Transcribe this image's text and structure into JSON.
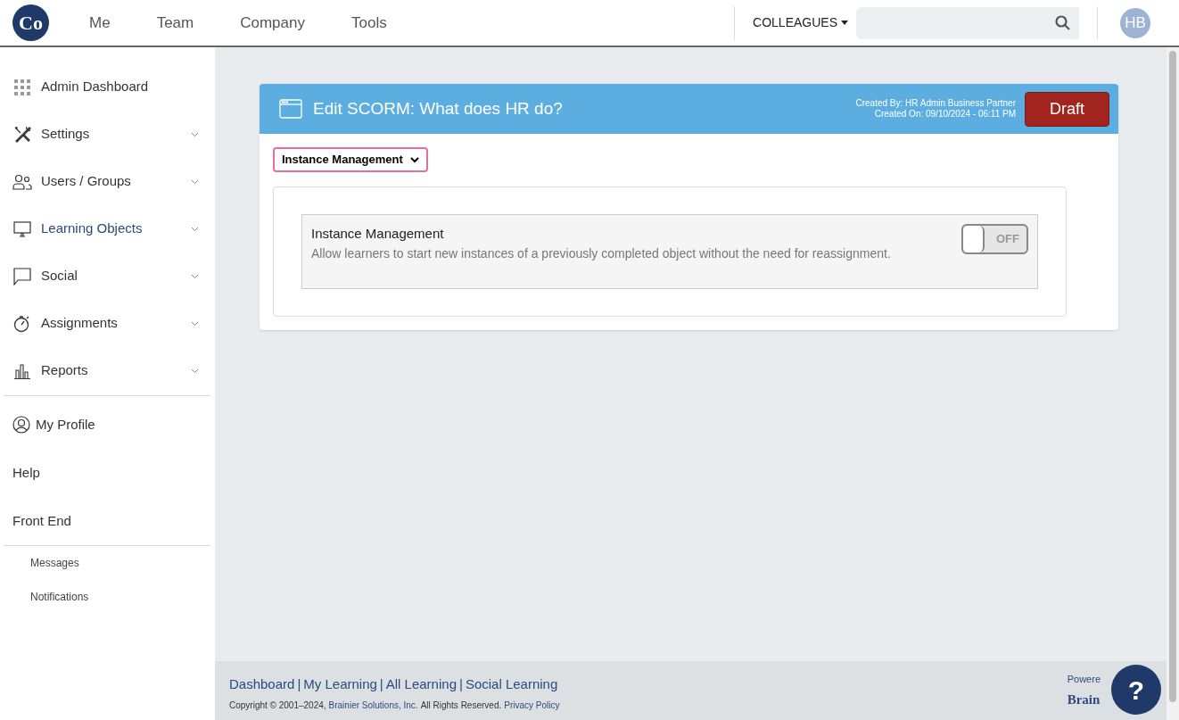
{
  "logo": {
    "text": "Co"
  },
  "nav": [
    {
      "label": "Me"
    },
    {
      "label": "Team"
    },
    {
      "label": "Company"
    },
    {
      "label": "Tools"
    }
  ],
  "search": {
    "scope": "COLLEAGUES"
  },
  "avatar": {
    "initials": "HB"
  },
  "sidebar": {
    "main": [
      {
        "label": "Admin Dashboard",
        "expandable": false,
        "selected": false
      },
      {
        "label": "Settings",
        "expandable": true,
        "selected": false
      },
      {
        "label": "Users / Groups",
        "expandable": true,
        "selected": false
      },
      {
        "label": "Learning Objects",
        "expandable": true,
        "selected": true
      },
      {
        "label": "Social",
        "expandable": true,
        "selected": false
      },
      {
        "label": "Assignments",
        "expandable": true,
        "selected": false
      },
      {
        "label": "Reports",
        "expandable": true,
        "selected": false
      }
    ],
    "account": [
      {
        "label": "My Profile",
        "icon": true
      },
      {
        "label": "Help",
        "icon": false
      },
      {
        "label": "Front End",
        "icon": false
      }
    ],
    "extra": [
      {
        "label": "Messages"
      },
      {
        "label": "Notifications"
      }
    ]
  },
  "panel": {
    "title": "Edit SCORM: What does HR do?",
    "created_by": "Created By: HR Admin Business Partner",
    "created_on": "Created On: 09/10/2024 - 06:11 PM",
    "status": "Draft",
    "section_select": "Instance Management",
    "settings": [
      {
        "title": "Instance Management",
        "description": "Allow learners to start new instances of a previously completed object without the need for reassignment.",
        "on": false,
        "state_label": "OFF"
      }
    ]
  },
  "footer": {
    "separator": "|",
    "links": [
      {
        "label": "Dashboard"
      },
      {
        "label": "My Learning"
      },
      {
        "label": "All Learning"
      },
      {
        "label": "Social Learning"
      }
    ],
    "copyright": "Copyright © 2001–2024,",
    "company_link": "Brainier Solutions, Inc.",
    "rights": "All Rights Reserved.",
    "privacy_link": "Privacy Policy",
    "powered": "Powere",
    "brand": "Brain",
    "help": "?"
  }
}
